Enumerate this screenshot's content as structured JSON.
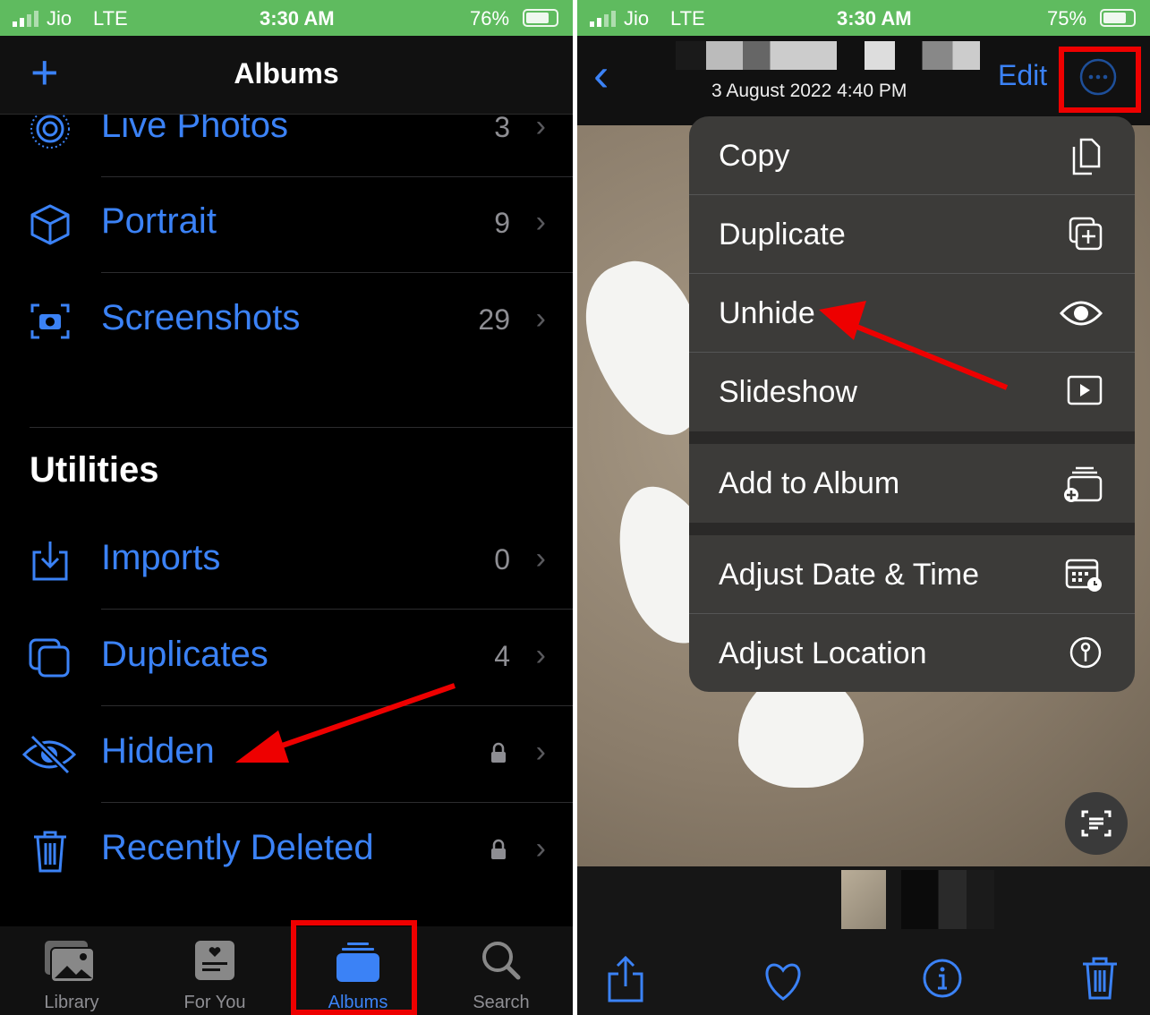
{
  "left": {
    "status": {
      "carrier": "Jio",
      "network": "LTE",
      "time": "3:30 AM",
      "battery": "76%"
    },
    "nav": {
      "title": "Albums",
      "add_icon": "plus-icon"
    },
    "media_types": [
      {
        "label": "Live Photos",
        "count": "3",
        "icon": "live-photos-icon"
      },
      {
        "label": "Portrait",
        "count": "9",
        "icon": "cube-icon"
      },
      {
        "label": "Screenshots",
        "count": "29",
        "icon": "screenshot-icon"
      }
    ],
    "utilities_title": "Utilities",
    "utilities": [
      {
        "label": "Imports",
        "count": "0",
        "icon": "import-icon"
      },
      {
        "label": "Duplicates",
        "count": "4",
        "icon": "duplicates-icon"
      },
      {
        "label": "Hidden",
        "count": "",
        "icon": "eye-slash-icon",
        "locked": true
      },
      {
        "label": "Recently Deleted",
        "count": "",
        "icon": "trash-icon",
        "locked": true
      }
    ],
    "tabs": [
      {
        "label": "Library"
      },
      {
        "label": "For You"
      },
      {
        "label": "Albums",
        "active": true
      },
      {
        "label": "Search"
      }
    ]
  },
  "right": {
    "status": {
      "carrier": "Jio",
      "network": "LTE",
      "time": "3:30 AM",
      "battery": "75%"
    },
    "nav": {
      "date": "3 August 2022  4:40 PM",
      "edit": "Edit",
      "more_icon": "ellipsis-circle-icon"
    },
    "menu": [
      {
        "label": "Copy",
        "icon": "copy-icon"
      },
      {
        "label": "Duplicate",
        "icon": "duplicate-icon"
      },
      {
        "label": "Unhide",
        "icon": "eye-icon"
      },
      {
        "label": "Slideshow",
        "icon": "play-icon"
      },
      {
        "label": "Add to Album",
        "icon": "add-album-icon"
      },
      {
        "label": "Adjust Date & Time",
        "icon": "calendar-clock-icon"
      },
      {
        "label": "Adjust Location",
        "icon": "location-info-icon"
      }
    ],
    "toolbar": [
      "share-icon",
      "heart-icon",
      "info-icon",
      "trash-icon"
    ]
  },
  "colors": {
    "accent": "#3b82f6",
    "status_bar": "#5fbb5f",
    "highlight": "#e00000"
  }
}
